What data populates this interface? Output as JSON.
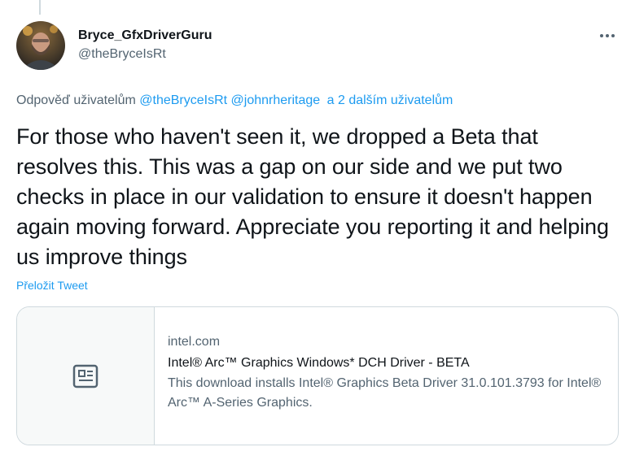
{
  "author": {
    "display_name": "Bryce_GfxDriverGuru",
    "handle": "@theBryceIsRt",
    "avatar_icon": "profile-photo"
  },
  "reply": {
    "prefix": "Odpověď uživatelům",
    "mention_1": "@theBryceIsRt",
    "mention_2": "@johnrheritage",
    "others": "a 2 dalším uživatelům"
  },
  "tweet": {
    "text": "For those who haven't seen it, we dropped a Beta that resolves this. This was a gap on our side and we put two checks in place in our validation to ensure it doesn't happen again moving forward. Appreciate you reporting it and helping us improve things",
    "translate_label": "Přeložit Tweet"
  },
  "card": {
    "domain": "intel.com",
    "title": "Intel® Arc™ Graphics Windows* DCH Driver - BETA",
    "description": "This download installs Intel® Graphics Beta Driver 31.0.101.3793 for Intel® Arc™ A-Series Graphics.",
    "icon": "article-icon"
  },
  "colors": {
    "link": "#1d9bf0",
    "secondary_text": "#536471",
    "primary_text": "#0f1419",
    "border": "#cfd9de"
  }
}
